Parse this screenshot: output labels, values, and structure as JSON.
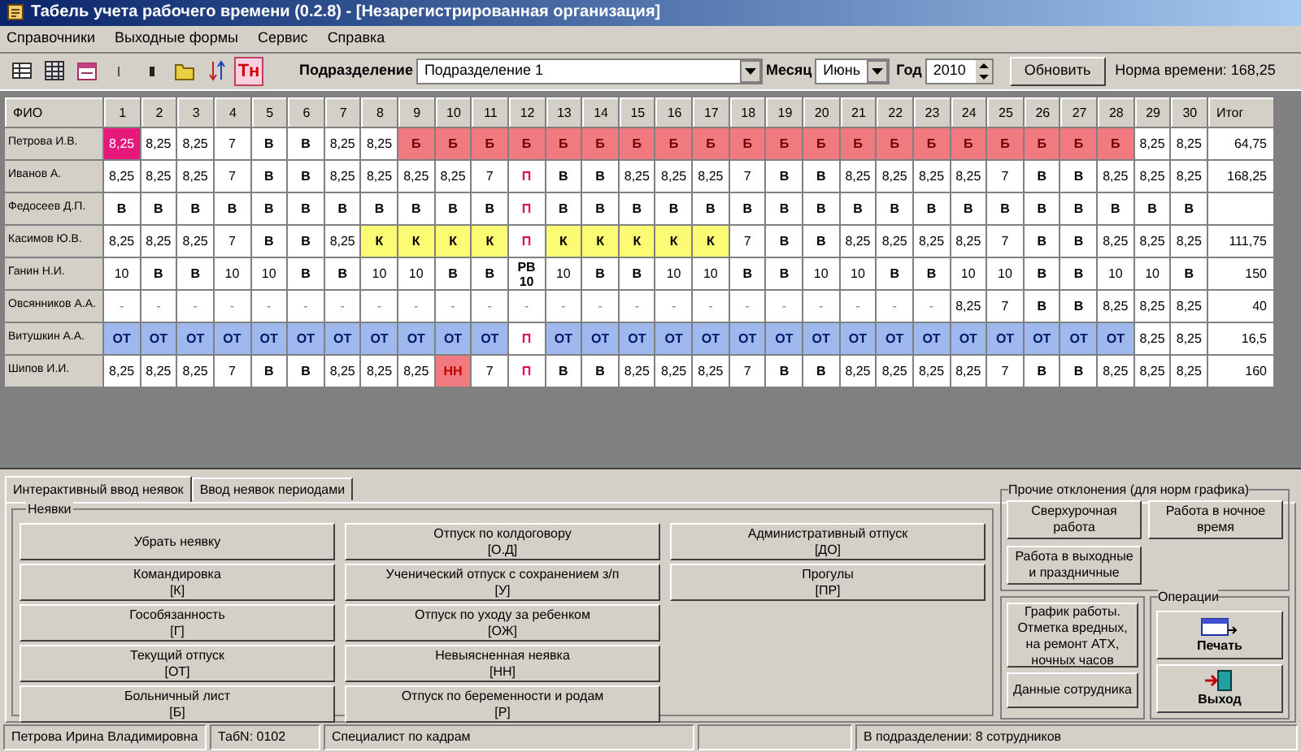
{
  "window": {
    "title": "Табель учета рабочего времени (0.2.8) - [Незарегистрированная организация]"
  },
  "menu": [
    "Справочники",
    "Выходные формы",
    "Сервис",
    "Справка"
  ],
  "toolbar": {
    "badge": "Тн",
    "department_label": "Подразделение",
    "department": "Подразделение 1",
    "month_label": "Месяц",
    "month": "Июнь",
    "year_label": "Год",
    "year": "2010",
    "refresh": "Обновить",
    "norm": "Норма времени: 168,25"
  },
  "table": {
    "columns": [
      "ФИО",
      "1",
      "2",
      "3",
      "4",
      "5",
      "6",
      "7",
      "8",
      "9",
      "10",
      "11",
      "12",
      "13",
      "14",
      "15",
      "16",
      "17",
      "18",
      "19",
      "20",
      "21",
      "22",
      "23",
      "24",
      "25",
      "26",
      "27",
      "28",
      "29",
      "30",
      "Итог"
    ],
    "rows": [
      {
        "name": "Петрова И.В.",
        "total": "64,75",
        "days": [
          {
            "text": "8,25",
            "kind": "work",
            "selected": true
          },
          {
            "text": "8,25",
            "kind": "work",
            "selected": false
          },
          {
            "text": "8,25",
            "kind": "work",
            "selected": false
          },
          {
            "text": "7",
            "kind": "work",
            "selected": false
          },
          {
            "text": "В",
            "kind": "weekend",
            "selected": false
          },
          {
            "text": "В",
            "kind": "weekend",
            "selected": false
          },
          {
            "text": "8,25",
            "kind": "work",
            "selected": false
          },
          {
            "text": "8,25",
            "kind": "work",
            "selected": false
          },
          {
            "text": "Б",
            "kind": "sick",
            "selected": false
          },
          {
            "text": "Б",
            "kind": "sick",
            "selected": false
          },
          {
            "text": "Б",
            "kind": "sick",
            "selected": false
          },
          {
            "text": "Б",
            "kind": "sick",
            "selected": false
          },
          {
            "text": "Б",
            "kind": "sick",
            "selected": false
          },
          {
            "text": "Б",
            "kind": "sick",
            "selected": false
          },
          {
            "text": "Б",
            "kind": "sick",
            "selected": false
          },
          {
            "text": "Б",
            "kind": "sick",
            "selected": false
          },
          {
            "text": "Б",
            "kind": "sick",
            "selected": false
          },
          {
            "text": "Б",
            "kind": "sick",
            "selected": false
          },
          {
            "text": "Б",
            "kind": "sick",
            "selected": false
          },
          {
            "text": "Б",
            "kind": "sick",
            "selected": false
          },
          {
            "text": "Б",
            "kind": "sick",
            "selected": false
          },
          {
            "text": "Б",
            "kind": "sick",
            "selected": false
          },
          {
            "text": "Б",
            "kind": "sick",
            "selected": false
          },
          {
            "text": "Б",
            "kind": "sick",
            "selected": false
          },
          {
            "text": "Б",
            "kind": "sick",
            "selected": false
          },
          {
            "text": "Б",
            "kind": "sick",
            "selected": false
          },
          {
            "text": "Б",
            "kind": "sick",
            "selected": false
          },
          {
            "text": "Б",
            "kind": "sick",
            "selected": false
          },
          {
            "text": "8,25",
            "kind": "work",
            "selected": false
          },
          {
            "text": "8,25",
            "kind": "work",
            "selected": false
          }
        ]
      },
      {
        "name": "Иванов А.",
        "total": "168,25",
        "days": [
          {
            "text": "8,25",
            "kind": "work",
            "selected": false
          },
          {
            "text": "8,25",
            "kind": "work",
            "selected": false
          },
          {
            "text": "8,25",
            "kind": "work",
            "selected": false
          },
          {
            "text": "7",
            "kind": "work",
            "selected": false
          },
          {
            "text": "В",
            "kind": "weekend",
            "selected": false
          },
          {
            "text": "В",
            "kind": "weekend",
            "selected": false
          },
          {
            "text": "8,25",
            "kind": "work",
            "selected": false
          },
          {
            "text": "8,25",
            "kind": "work",
            "selected": false
          },
          {
            "text": "8,25",
            "kind": "work",
            "selected": false
          },
          {
            "text": "8,25",
            "kind": "work",
            "selected": false
          },
          {
            "text": "7",
            "kind": "work",
            "selected": false
          },
          {
            "text": "П",
            "kind": "holiday",
            "selected": false
          },
          {
            "text": "В",
            "kind": "weekend",
            "selected": false
          },
          {
            "text": "В",
            "kind": "weekend",
            "selected": false
          },
          {
            "text": "8,25",
            "kind": "work",
            "selected": false
          },
          {
            "text": "8,25",
            "kind": "work",
            "selected": false
          },
          {
            "text": "8,25",
            "kind": "work",
            "selected": false
          },
          {
            "text": "7",
            "kind": "work",
            "selected": false
          },
          {
            "text": "В",
            "kind": "weekend",
            "selected": false
          },
          {
            "text": "В",
            "kind": "weekend",
            "selected": false
          },
          {
            "text": "8,25",
            "kind": "work",
            "selected": false
          },
          {
            "text": "8,25",
            "kind": "work",
            "selected": false
          },
          {
            "text": "8,25",
            "kind": "work",
            "selected": false
          },
          {
            "text": "8,25",
            "kind": "work",
            "selected": false
          },
          {
            "text": "7",
            "kind": "work",
            "selected": false
          },
          {
            "text": "В",
            "kind": "weekend",
            "selected": false
          },
          {
            "text": "В",
            "kind": "weekend",
            "selected": false
          },
          {
            "text": "8,25",
            "kind": "work",
            "selected": false
          },
          {
            "text": "8,25",
            "kind": "work",
            "selected": false
          },
          {
            "text": "8,25",
            "kind": "work",
            "selected": false
          }
        ]
      },
      {
        "name": "Федосеев Д.П.",
        "days": [
          {
            "text": "В",
            "kind": "weekend",
            "selected": false
          },
          {
            "text": "В",
            "kind": "weekend",
            "selected": false
          },
          {
            "text": "В",
            "kind": "weekend",
            "selected": false
          },
          {
            "text": "В",
            "kind": "weekend",
            "selected": false
          },
          {
            "text": "В",
            "kind": "weekend",
            "selected": false
          },
          {
            "text": "В",
            "kind": "weekend",
            "selected": false
          },
          {
            "text": "В",
            "kind": "weekend",
            "selected": false
          },
          {
            "text": "В",
            "kind": "weekend",
            "selected": false
          },
          {
            "text": "В",
            "kind": "weekend",
            "selected": false
          },
          {
            "text": "В",
            "kind": "weekend",
            "selected": false
          },
          {
            "text": "В",
            "kind": "weekend",
            "selected": false
          },
          {
            "text": "П",
            "kind": "holiday",
            "selected": false
          },
          {
            "text": "В",
            "kind": "weekend",
            "selected": false
          },
          {
            "text": "В",
            "kind": "weekend",
            "selected": false
          },
          {
            "text": "В",
            "kind": "weekend",
            "selected": false
          },
          {
            "text": "В",
            "kind": "weekend",
            "selected": false
          },
          {
            "text": "В",
            "kind": "weekend",
            "selected": false
          },
          {
            "text": "В",
            "kind": "weekend",
            "selected": false
          },
          {
            "text": "В",
            "kind": "weekend",
            "selected": false
          },
          {
            "text": "В",
            "kind": "weekend",
            "selected": false
          },
          {
            "text": "В",
            "kind": "weekend",
            "selected": false
          },
          {
            "text": "В",
            "kind": "weekend",
            "selected": false
          },
          {
            "text": "В",
            "kind": "weekend",
            "selected": false
          },
          {
            "text": "В",
            "kind": "weekend",
            "selected": false
          },
          {
            "text": "В",
            "kind": "weekend",
            "selected": false
          },
          {
            "text": "В",
            "kind": "weekend",
            "selected": false
          },
          {
            "text": "В",
            "kind": "weekend",
            "selected": false
          },
          {
            "text": "В",
            "kind": "weekend",
            "selected": false
          },
          {
            "text": "В",
            "kind": "weekend",
            "selected": false
          },
          {
            "text": "В",
            "kind": "weekend",
            "selected": false
          }
        ]
      },
      {
        "name": "Касимов Ю.В.",
        "total": "111,75",
        "days": [
          {
            "text": "8,25",
            "kind": "work",
            "selected": false
          },
          {
            "text": "8,25",
            "kind": "work",
            "selected": false
          },
          {
            "text": "8,25",
            "kind": "work",
            "selected": false
          },
          {
            "text": "7",
            "kind": "work",
            "selected": false
          },
          {
            "text": "В",
            "kind": "weekend",
            "selected": false
          },
          {
            "text": "В",
            "kind": "weekend",
            "selected": false
          },
          {
            "text": "8,25",
            "kind": "work",
            "selected": false
          },
          {
            "text": "К",
            "kind": "trip",
            "selected": false
          },
          {
            "text": "К",
            "kind": "trip",
            "selected": false
          },
          {
            "text": "К",
            "kind": "trip",
            "selected": false
          },
          {
            "text": "К",
            "kind": "trip",
            "selected": false
          },
          {
            "text": "П",
            "kind": "holiday",
            "selected": false
          },
          {
            "text": "К",
            "kind": "trip",
            "selected": false
          },
          {
            "text": "К",
            "kind": "trip",
            "selected": false
          },
          {
            "text": "К",
            "kind": "trip",
            "selected": false
          },
          {
            "text": "К",
            "kind": "trip",
            "selected": false
          },
          {
            "text": "К",
            "kind": "trip",
            "selected": false
          },
          {
            "text": "7",
            "kind": "work",
            "selected": false
          },
          {
            "text": "В",
            "kind": "weekend",
            "selected": false
          },
          {
            "text": "В",
            "kind": "weekend",
            "selected": false
          },
          {
            "text": "8,25",
            "kind": "work",
            "selected": false
          },
          {
            "text": "8,25",
            "kind": "work",
            "selected": false
          },
          {
            "text": "8,25",
            "kind": "work",
            "selected": false
          },
          {
            "text": "8,25",
            "kind": "work",
            "selected": false
          },
          {
            "text": "7",
            "kind": "work",
            "selected": false
          },
          {
            "text": "В",
            "kind": "weekend",
            "selected": false
          },
          {
            "text": "В",
            "kind": "weekend",
            "selected": false
          },
          {
            "text": "8,25",
            "kind": "work",
            "selected": false
          },
          {
            "text": "8,25",
            "kind": "work",
            "selected": false
          },
          {
            "text": "8,25",
            "kind": "work",
            "selected": false
          }
        ]
      },
      {
        "name": "Ганин Н.И.",
        "total": "150",
        "days": [
          {
            "text": "10",
            "kind": "work",
            "selected": false
          },
          {
            "text": "В",
            "kind": "weekend",
            "selected": false
          },
          {
            "text": "В",
            "kind": "weekend",
            "selected": false
          },
          {
            "text": "10",
            "kind": "work",
            "selected": false
          },
          {
            "text": "10",
            "kind": "work",
            "selected": false
          },
          {
            "text": "В",
            "kind": "weekend",
            "selected": false
          },
          {
            "text": "В",
            "kind": "weekend",
            "selected": false
          },
          {
            "text": "10",
            "kind": "work",
            "selected": false
          },
          {
            "text": "10",
            "kind": "work",
            "selected": false
          },
          {
            "text": "В",
            "kind": "weekend",
            "selected": false
          },
          {
            "text": "В",
            "kind": "weekend",
            "selected": false
          },
          {
            "text": "РВ 10",
            "kind": "holiday_work",
            "selected": false
          },
          {
            "text": "10",
            "kind": "work",
            "selected": false
          },
          {
            "text": "В",
            "kind": "weekend",
            "selected": false
          },
          {
            "text": "В",
            "kind": "weekend",
            "selected": false
          },
          {
            "text": "10",
            "kind": "work",
            "selected": false
          },
          {
            "text": "10",
            "kind": "work",
            "selected": false
          },
          {
            "text": "В",
            "kind": "weekend",
            "selected": false
          },
          {
            "text": "В",
            "kind": "weekend",
            "selected": false
          },
          {
            "text": "10",
            "kind": "work",
            "selected": false
          },
          {
            "text": "10",
            "kind": "work",
            "selected": false
          },
          {
            "text": "В",
            "kind": "weekend",
            "selected": false
          },
          {
            "text": "В",
            "kind": "weekend",
            "selected": false
          },
          {
            "text": "10",
            "kind": "work",
            "selected": false
          },
          {
            "text": "10",
            "kind": "work",
            "selected": false
          },
          {
            "text": "В",
            "kind": "weekend",
            "selected": false
          },
          {
            "text": "В",
            "kind": "weekend",
            "selected": false
          },
          {
            "text": "10",
            "kind": "work",
            "selected": false
          },
          {
            "text": "10",
            "kind": "work",
            "selected": false
          },
          {
            "text": "В",
            "kind": "weekend",
            "selected": false
          }
        ]
      },
      {
        "name": "Овсянников А.А.",
        "total": "40",
        "days": [
          {
            "text": "-",
            "kind": "none",
            "selected": false
          },
          {
            "text": "-",
            "kind": "none",
            "selected": false
          },
          {
            "text": "-",
            "kind": "none",
            "selected": false
          },
          {
            "text": "-",
            "kind": "none",
            "selected": false
          },
          {
            "text": "-",
            "kind": "none",
            "selected": false
          },
          {
            "text": "-",
            "kind": "none",
            "selected": false
          },
          {
            "text": "-",
            "kind": "none",
            "selected": false
          },
          {
            "text": "-",
            "kind": "none",
            "selected": false
          },
          {
            "text": "-",
            "kind": "none",
            "selected": false
          },
          {
            "text": "-",
            "kind": "none",
            "selected": false
          },
          {
            "text": "-",
            "kind": "none",
            "selected": false
          },
          {
            "text": "-",
            "kind": "none",
            "selected": false
          },
          {
            "text": "-",
            "kind": "none",
            "selected": false
          },
          {
            "text": "-",
            "kind": "none",
            "selected": false
          },
          {
            "text": "-",
            "kind": "none",
            "selected": false
          },
          {
            "text": "-",
            "kind": "none",
            "selected": false
          },
          {
            "text": "-",
            "kind": "none",
            "selected": false
          },
          {
            "text": "-",
            "kind": "none",
            "selected": false
          },
          {
            "text": "-",
            "kind": "none",
            "selected": false
          },
          {
            "text": "-",
            "kind": "none",
            "selected": false
          },
          {
            "text": "-",
            "kind": "none",
            "selected": false
          },
          {
            "text": "-",
            "kind": "none",
            "selected": false
          },
          {
            "text": "-",
            "kind": "none",
            "selected": false
          },
          {
            "text": "8,25",
            "kind": "work",
            "selected": false
          },
          {
            "text": "7",
            "kind": "work",
            "selected": false
          },
          {
            "text": "В",
            "kind": "weekend",
            "selected": false
          },
          {
            "text": "В",
            "kind": "weekend",
            "selected": false
          },
          {
            "text": "8,25",
            "kind": "work",
            "selected": false
          },
          {
            "text": "8,25",
            "kind": "work",
            "selected": false
          },
          {
            "text": "8,25",
            "kind": "work",
            "selected": false
          }
        ]
      },
      {
        "name": "Витушкин А.А.",
        "total": "16,5",
        "days": [
          {
            "text": "ОТ",
            "kind": "vacation",
            "selected": false
          },
          {
            "text": "ОТ",
            "kind": "vacation",
            "selected": false
          },
          {
            "text": "ОТ",
            "kind": "vacation",
            "selected": false
          },
          {
            "text": "ОТ",
            "kind": "vacation",
            "selected": false
          },
          {
            "text": "ОТ",
            "kind": "vacation",
            "selected": false
          },
          {
            "text": "ОТ",
            "kind": "vacation",
            "selected": false
          },
          {
            "text": "ОТ",
            "kind": "vacation",
            "selected": false
          },
          {
            "text": "ОТ",
            "kind": "vacation",
            "selected": false
          },
          {
            "text": "ОТ",
            "kind": "vacation",
            "selected": false
          },
          {
            "text": "ОТ",
            "kind": "vacation",
            "selected": false
          },
          {
            "text": "ОТ",
            "kind": "vacation",
            "selected": false
          },
          {
            "text": "П",
            "kind": "holiday",
            "selected": false
          },
          {
            "text": "ОТ",
            "kind": "vacation",
            "selected": false
          },
          {
            "text": "ОТ",
            "kind": "vacation",
            "selected": false
          },
          {
            "text": "ОТ",
            "kind": "vacation",
            "selected": false
          },
          {
            "text": "ОТ",
            "kind": "vacation",
            "selected": false
          },
          {
            "text": "ОТ",
            "kind": "vacation",
            "selected": false
          },
          {
            "text": "ОТ",
            "kind": "vacation",
            "selected": false
          },
          {
            "text": "ОТ",
            "kind": "vacation",
            "selected": false
          },
          {
            "text": "ОТ",
            "kind": "vacation",
            "selected": false
          },
          {
            "text": "ОТ",
            "kind": "vacation",
            "selected": false
          },
          {
            "text": "ОТ",
            "kind": "vacation",
            "selected": false
          },
          {
            "text": "ОТ",
            "kind": "vacation",
            "selected": false
          },
          {
            "text": "ОТ",
            "kind": "vacation",
            "selected": false
          },
          {
            "text": "ОТ",
            "kind": "vacation",
            "selected": false
          },
          {
            "text": "ОТ",
            "kind": "vacation",
            "selected": false
          },
          {
            "text": "ОТ",
            "kind": "vacation",
            "selected": false
          },
          {
            "text": "ОТ",
            "kind": "vacation",
            "selected": false
          },
          {
            "text": "8,25",
            "kind": "work",
            "selected": false
          },
          {
            "text": "8,25",
            "kind": "work",
            "selected": false
          }
        ]
      },
      {
        "name": "Шипов И.И.",
        "total": "160",
        "days": [
          {
            "text": "8,25",
            "kind": "work",
            "selected": false
          },
          {
            "text": "8,25",
            "kind": "work",
            "selected": false
          },
          {
            "text": "8,25",
            "kind": "work",
            "selected": false
          },
          {
            "text": "7",
            "kind": "work",
            "selected": false
          },
          {
            "text": "В",
            "kind": "weekend",
            "selected": false
          },
          {
            "text": "В",
            "kind": "weekend",
            "selected": false
          },
          {
            "text": "8,25",
            "kind": "work",
            "selected": false
          },
          {
            "text": "8,25",
            "kind": "work",
            "selected": false
          },
          {
            "text": "8,25",
            "kind": "work",
            "selected": false
          },
          {
            "text": "НН",
            "kind": "unexplained",
            "selected": false
          },
          {
            "text": "7",
            "kind": "work",
            "selected": false
          },
          {
            "text": "П",
            "kind": "holiday",
            "selected": false
          },
          {
            "text": "В",
            "kind": "weekend",
            "selected": false
          },
          {
            "text": "В",
            "kind": "weekend",
            "selected": false
          },
          {
            "text": "8,25",
            "kind": "work",
            "selected": false
          },
          {
            "text": "8,25",
            "kind": "work",
            "selected": false
          },
          {
            "text": "8,25",
            "kind": "work",
            "selected": false
          },
          {
            "text": "7",
            "kind": "work",
            "selected": false
          },
          {
            "text": "В",
            "kind": "weekend",
            "selected": false
          },
          {
            "text": "В",
            "kind": "weekend",
            "selected": false
          },
          {
            "text": "8,25",
            "kind": "work",
            "selected": false
          },
          {
            "text": "8,25",
            "kind": "work",
            "selected": false
          },
          {
            "text": "8,25",
            "kind": "work",
            "selected": false
          },
          {
            "text": "8,25",
            "kind": "work",
            "selected": false
          },
          {
            "text": "7",
            "kind": "work",
            "selected": false
          },
          {
            "text": "В",
            "kind": "weekend",
            "selected": false
          },
          {
            "text": "В",
            "kind": "weekend",
            "selected": false
          },
          {
            "text": "8,25",
            "kind": "work",
            "selected": false
          },
          {
            "text": "8,25",
            "kind": "work",
            "selected": false
          },
          {
            "text": "8,25",
            "kind": "work",
            "selected": false
          }
        ]
      }
    ]
  },
  "tabs": [
    {
      "label": "Интерактивный ввод неявок",
      "selected": true
    },
    {
      "label": "Ввод неявок периодами",
      "selected": false
    }
  ],
  "absences": {
    "title": "Неявки",
    "buttons": [
      {
        "label": "Убрать неявку"
      },
      {
        "label": "Отпуск по колдоговору",
        "code": "[О.Д]"
      },
      {
        "label": "Административный отпуск",
        "code": "[ДО]"
      },
      {
        "label": "Командировка",
        "code": "[К]"
      },
      {
        "label": "Ученический отпуск с сохранением з/п",
        "code": "[У]"
      },
      {
        "label": "Прогулы",
        "code": "[ПР]"
      },
      {
        "label": "Гособязанность",
        "code": "[Г]"
      },
      {
        "label": "Отпуск по уходу за ребенком",
        "code": "[ОЖ]"
      },
      {
        "label": "Текущий отпуск",
        "code": "[ОТ]"
      },
      {
        "label": "Невыясненная неявка",
        "code": "[НН]"
      },
      {
        "label": "Больничный лист",
        "code": "[Б]"
      },
      {
        "label": "Отпуск по беременности и родам",
        "code": "[Р]"
      }
    ]
  },
  "other": {
    "title": "Прочие отклонения (для норм графика)",
    "buttons": [
      "Сверхурочная работа",
      "Работа в ночное время",
      "Работа в выходные и праздничные"
    ]
  },
  "schedule_button": "График работы. Отметка вредных, на ремонт АТХ, ночных часов",
  "employee_button": "Данные сотрудника",
  "operations": {
    "title": "Операции",
    "print": "Печать",
    "exit": "Выход"
  },
  "status_bar": [
    "Петрова Ирина Владимировна",
    "ТабN: 0102",
    "Специалист по кадрам",
    "В подразделении: 8 сотрудников"
  ]
}
